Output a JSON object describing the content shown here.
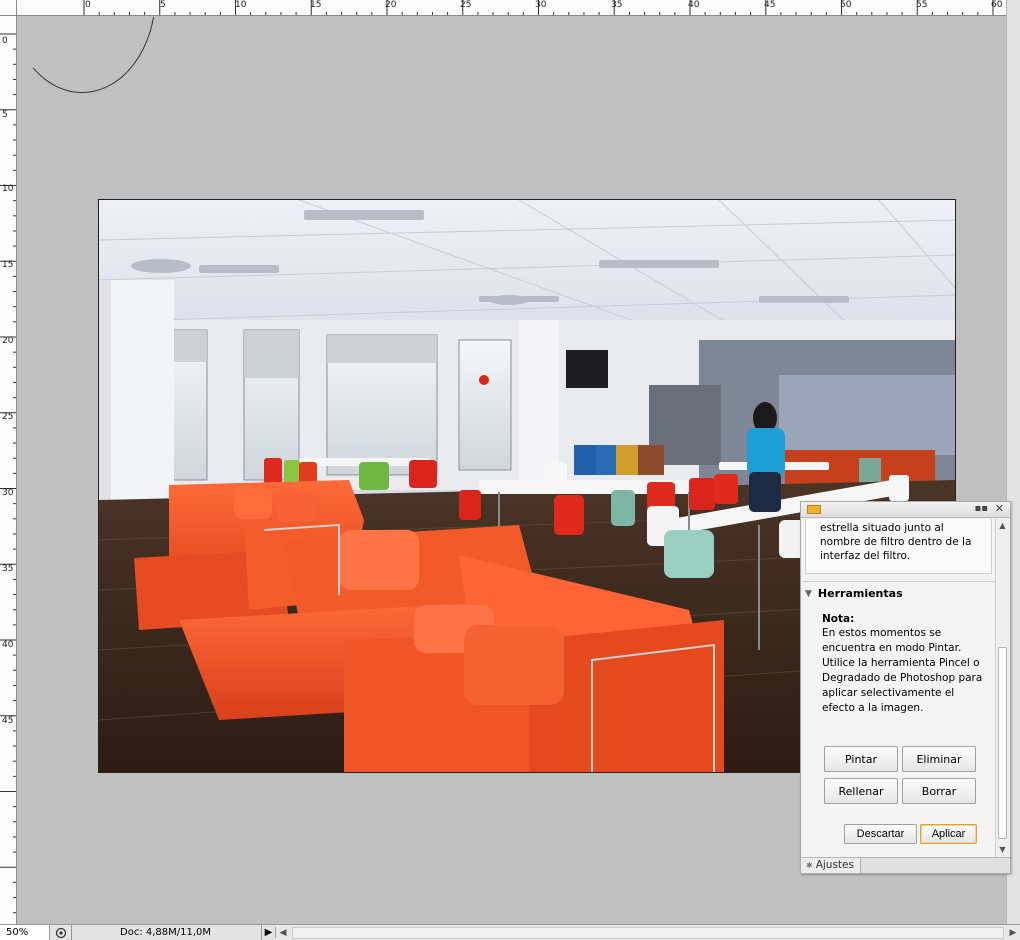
{
  "ruler": {
    "top_labels": [
      "0",
      "5",
      "10",
      "15",
      "20",
      "25",
      "30",
      "35",
      "40",
      "45",
      "50",
      "55",
      "60"
    ],
    "left_labels": [
      "0",
      "5",
      "10",
      "15",
      "20",
      "25",
      "30",
      "35",
      "40",
      "45"
    ]
  },
  "photo": {
    "description_icon": "office-cafeteria-photo"
  },
  "status": {
    "zoom": "50%",
    "doc_info": "Doc: 4,88M/11,0M",
    "menu_arrow": "▶"
  },
  "panel": {
    "top_text": "estrella situado junto al nombre de filtro dentro de la interfaz del filtro.",
    "section_title": "Herramientas",
    "note_label": "Nota:",
    "note_text": "En estos momentos se encuentra en modo Pintar. Utilice la herramienta Pincel o Degradado de Photoshop para aplicar selectivamente el efecto a la imagen.",
    "buttons": {
      "pintar": "Pintar",
      "eliminar": "Eliminar",
      "rellenar": "Rellenar",
      "borrar": "Borrar",
      "descartar": "Descartar",
      "aplicar": "Aplicar"
    },
    "tab": "Ajustes",
    "minimize": "▪▪",
    "close": "✕"
  },
  "colors": {
    "canvas_bg": "#c0c0c0",
    "sofa": "#f2582a",
    "accent_button": "#d9a23a"
  }
}
